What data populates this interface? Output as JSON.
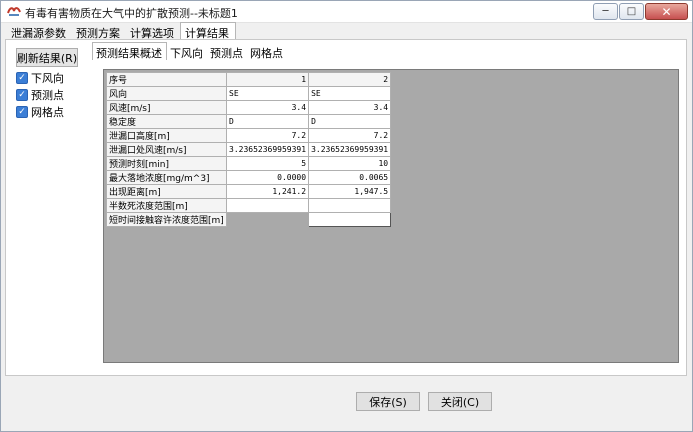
{
  "window": {
    "title": "有毒有害物质在大气中的扩散预测--未标题1",
    "buttons": {
      "minimize": "─",
      "maximize": "□",
      "close": "✕"
    }
  },
  "outer_tabs": [
    "泄漏源参数",
    "预测方案",
    "计算选项",
    "计算结果"
  ],
  "left_panel": {
    "refresh_label": "刷新结果(R)",
    "checkboxes": [
      {
        "label": "下风向",
        "checked": true
      },
      {
        "label": "预测点",
        "checked": true
      },
      {
        "label": "网格点",
        "checked": true
      }
    ]
  },
  "inner_tabs": [
    "预测结果概述",
    "下风向",
    "预测点",
    "网格点"
  ],
  "grid": {
    "header": {
      "label": "序号",
      "cols": [
        "1",
        "2"
      ]
    },
    "rows": [
      {
        "label": "风向",
        "values": [
          "SE",
          "SE"
        ],
        "align": "left"
      },
      {
        "label": "风速[m/s]",
        "values": [
          "3.4",
          "3.4"
        ],
        "align": "right"
      },
      {
        "label": "稳定度",
        "values": [
          "D",
          "D"
        ],
        "align": "left"
      },
      {
        "label": "泄漏口高度[m]",
        "values": [
          "7.2",
          "7.2"
        ],
        "align": "right"
      },
      {
        "label": "泄漏口处风速[m/s]",
        "values": [
          "3.23652369959391",
          "3.23652369959391"
        ],
        "align": "right"
      },
      {
        "label": "预测时刻[min]",
        "values": [
          "5",
          "10"
        ],
        "align": "right"
      },
      {
        "label": "最大落地浓度[mg/m^3]",
        "values": [
          "0.0000",
          "0.0065"
        ],
        "align": "right"
      },
      {
        "label": "出现距离[m]",
        "values": [
          "1,241.2",
          "1,947.5"
        ],
        "align": "right"
      },
      {
        "label": "半数死浓度范围[m]",
        "values": [
          "",
          ""
        ],
        "align": "right"
      },
      {
        "label": "短时间接触容许浓度范围[m]",
        "values": [
          "",
          ""
        ],
        "align": "right"
      }
    ]
  },
  "footer": {
    "save_label": "保存(S)",
    "close_label": "关闭(C)"
  }
}
